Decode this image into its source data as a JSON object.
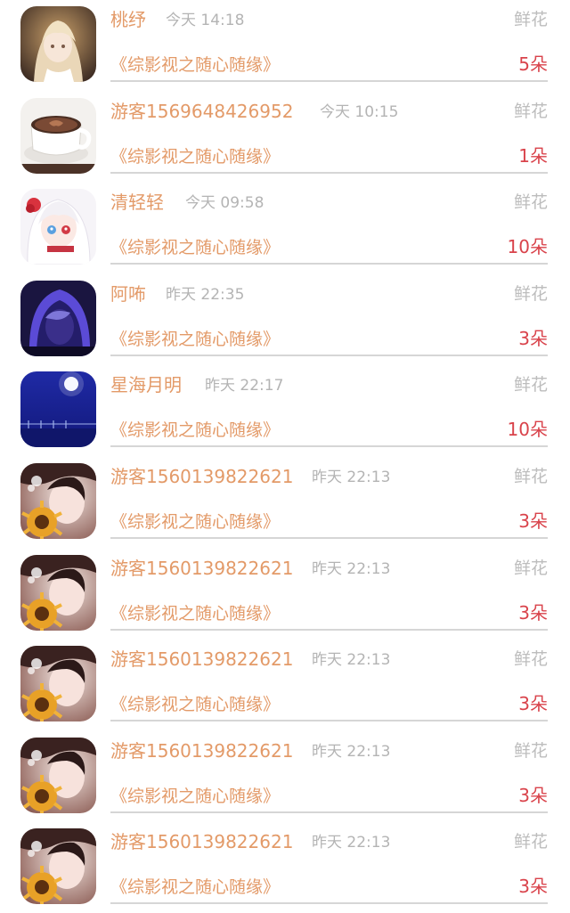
{
  "colors": {
    "name": "#E39A68",
    "time": "#B4B4B4",
    "gift": "#BDBDBD",
    "book": "#E39A68",
    "count": "#D9434B",
    "divider": "#D6D6D6"
  },
  "items": [
    {
      "name": "桃纾",
      "time": "今天 14:18",
      "gift": "鲜花",
      "book": "《综影视之随心随缘》",
      "count": "5朵",
      "avatar": "anime-girl-avatar"
    },
    {
      "name": "游客1569648426952",
      "time": "今天 10:15",
      "gift": "鲜花",
      "book": "《综影视之随心随缘》",
      "count": "1朵",
      "avatar": "coffee-cup-avatar"
    },
    {
      "name": "清轻轻",
      "time": "今天 09:58",
      "gift": "鲜花",
      "book": "《综影视之随心随缘》",
      "count": "10朵",
      "avatar": "anime-white-hair-avatar"
    },
    {
      "name": "阿咘",
      "time": "昨天 22:35",
      "gift": "鲜花",
      "book": "《综影视之随心随缘》",
      "count": "3朵",
      "avatar": "hooded-person-avatar"
    },
    {
      "name": "星海月明",
      "time": "昨天 22:17",
      "gift": "鲜花",
      "book": "《综影视之随心随缘》",
      "count": "10朵",
      "avatar": "moon-night-avatar"
    },
    {
      "name": "游客1560139822621",
      "time": "昨天 22:13",
      "gift": "鲜花",
      "book": "《综影视之随心随缘》",
      "count": "3朵",
      "avatar": "sunflower-girl-avatar"
    },
    {
      "name": "游客1560139822621",
      "time": "昨天 22:13",
      "gift": "鲜花",
      "book": "《综影视之随心随缘》",
      "count": "3朵",
      "avatar": "sunflower-girl-avatar"
    },
    {
      "name": "游客1560139822621",
      "time": "昨天 22:13",
      "gift": "鲜花",
      "book": "《综影视之随心随缘》",
      "count": "3朵",
      "avatar": "sunflower-girl-avatar"
    },
    {
      "name": "游客1560139822621",
      "time": "昨天 22:13",
      "gift": "鲜花",
      "book": "《综影视之随心随缘》",
      "count": "3朵",
      "avatar": "sunflower-girl-avatar"
    },
    {
      "name": "游客1560139822621",
      "time": "昨天 22:13",
      "gift": "鲜花",
      "book": "《综影视之随心随缘》",
      "count": "3朵",
      "avatar": "sunflower-girl-avatar"
    }
  ]
}
